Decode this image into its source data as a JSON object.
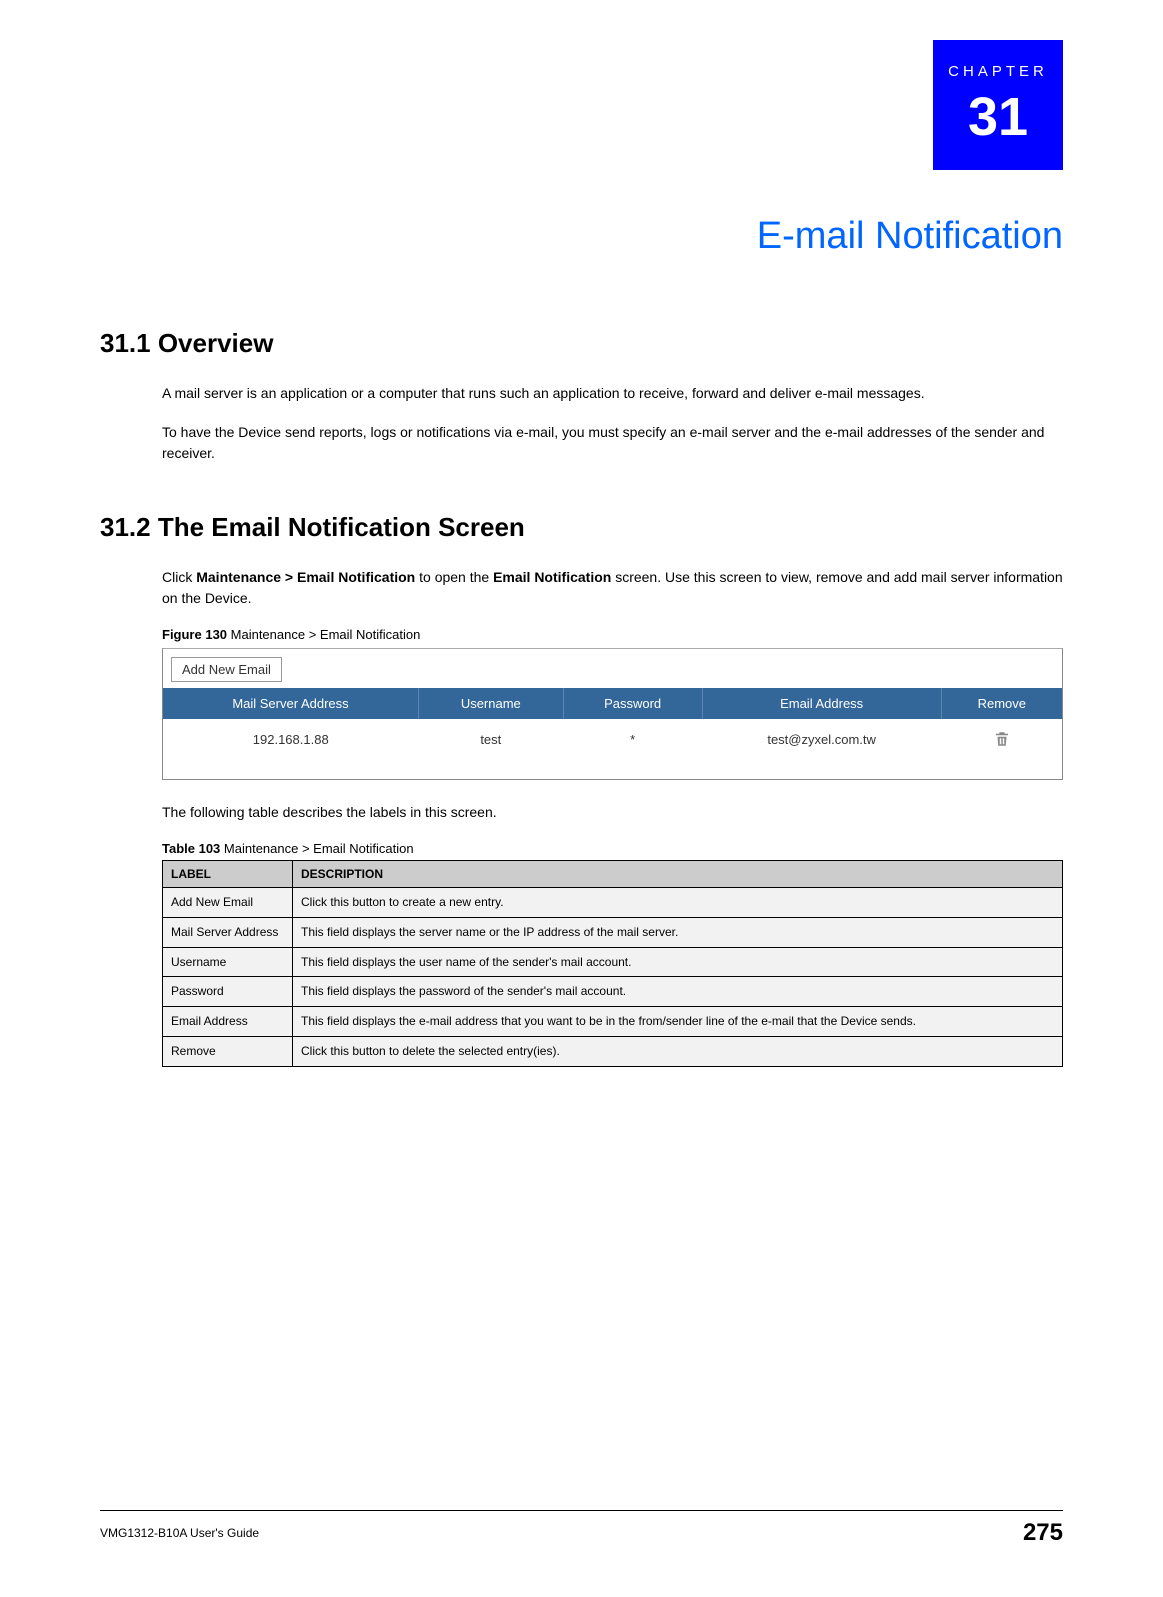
{
  "chapter": {
    "label": "CHAPTER",
    "number": "31",
    "title": "E-mail Notification"
  },
  "section1": {
    "heading": "31.1  Overview",
    "p1": "A mail server is an application or a computer that runs such an application to receive, forward and deliver e-mail messages.",
    "p2": "To have the Device send reports, logs or notifications via e-mail, you must specify an e-mail server and the e-mail addresses of the sender and receiver."
  },
  "section2": {
    "heading": "31.2  The Email Notification Screen",
    "intro_pre": "Click ",
    "intro_bold1": "Maintenance > Email Notification",
    "intro_mid": " to open the ",
    "intro_bold2": "Email Notification",
    "intro_post": " screen. Use this screen to view, remove and add mail server information on the Device."
  },
  "figure": {
    "label_bold": "Figure 130",
    "label_rest": "   Maintenance > Email Notification",
    "add_button": "Add New Email",
    "headers": {
      "c1": "Mail Server Address",
      "c2": "Username",
      "c3": "Password",
      "c4": "Email Address",
      "c5": "Remove"
    },
    "row": {
      "c1": "192.168.1.88",
      "c2": "test",
      "c3": "*",
      "c4": "test@zyxel.com.tw"
    }
  },
  "table_intro": "The following table describes the labels in this screen.",
  "table_label_bold": "Table 103",
  "table_label_rest": "   Maintenance > Email Notification",
  "desc_table": {
    "h1": "LABEL",
    "h2": "DESCRIPTION",
    "rows": [
      {
        "label": "Add New Email",
        "desc": "Click this button to create a new entry."
      },
      {
        "label": "Mail Server Address",
        "desc": "This field displays the server name or the IP address of the mail server."
      },
      {
        "label": "Username",
        "desc": "This field displays the user name of the sender's mail account."
      },
      {
        "label": "Password",
        "desc": "This field displays the password of the sender's mail account."
      },
      {
        "label": "Email Address",
        "desc": "This field displays the e-mail address that you want to be in the from/sender line of the e-mail that the Device sends."
      },
      {
        "label": "Remove",
        "desc": "Click this button to delete the selected entry(ies)."
      }
    ]
  },
  "footer": {
    "guide": "VMG1312-B10A User's Guide",
    "page": "275"
  }
}
